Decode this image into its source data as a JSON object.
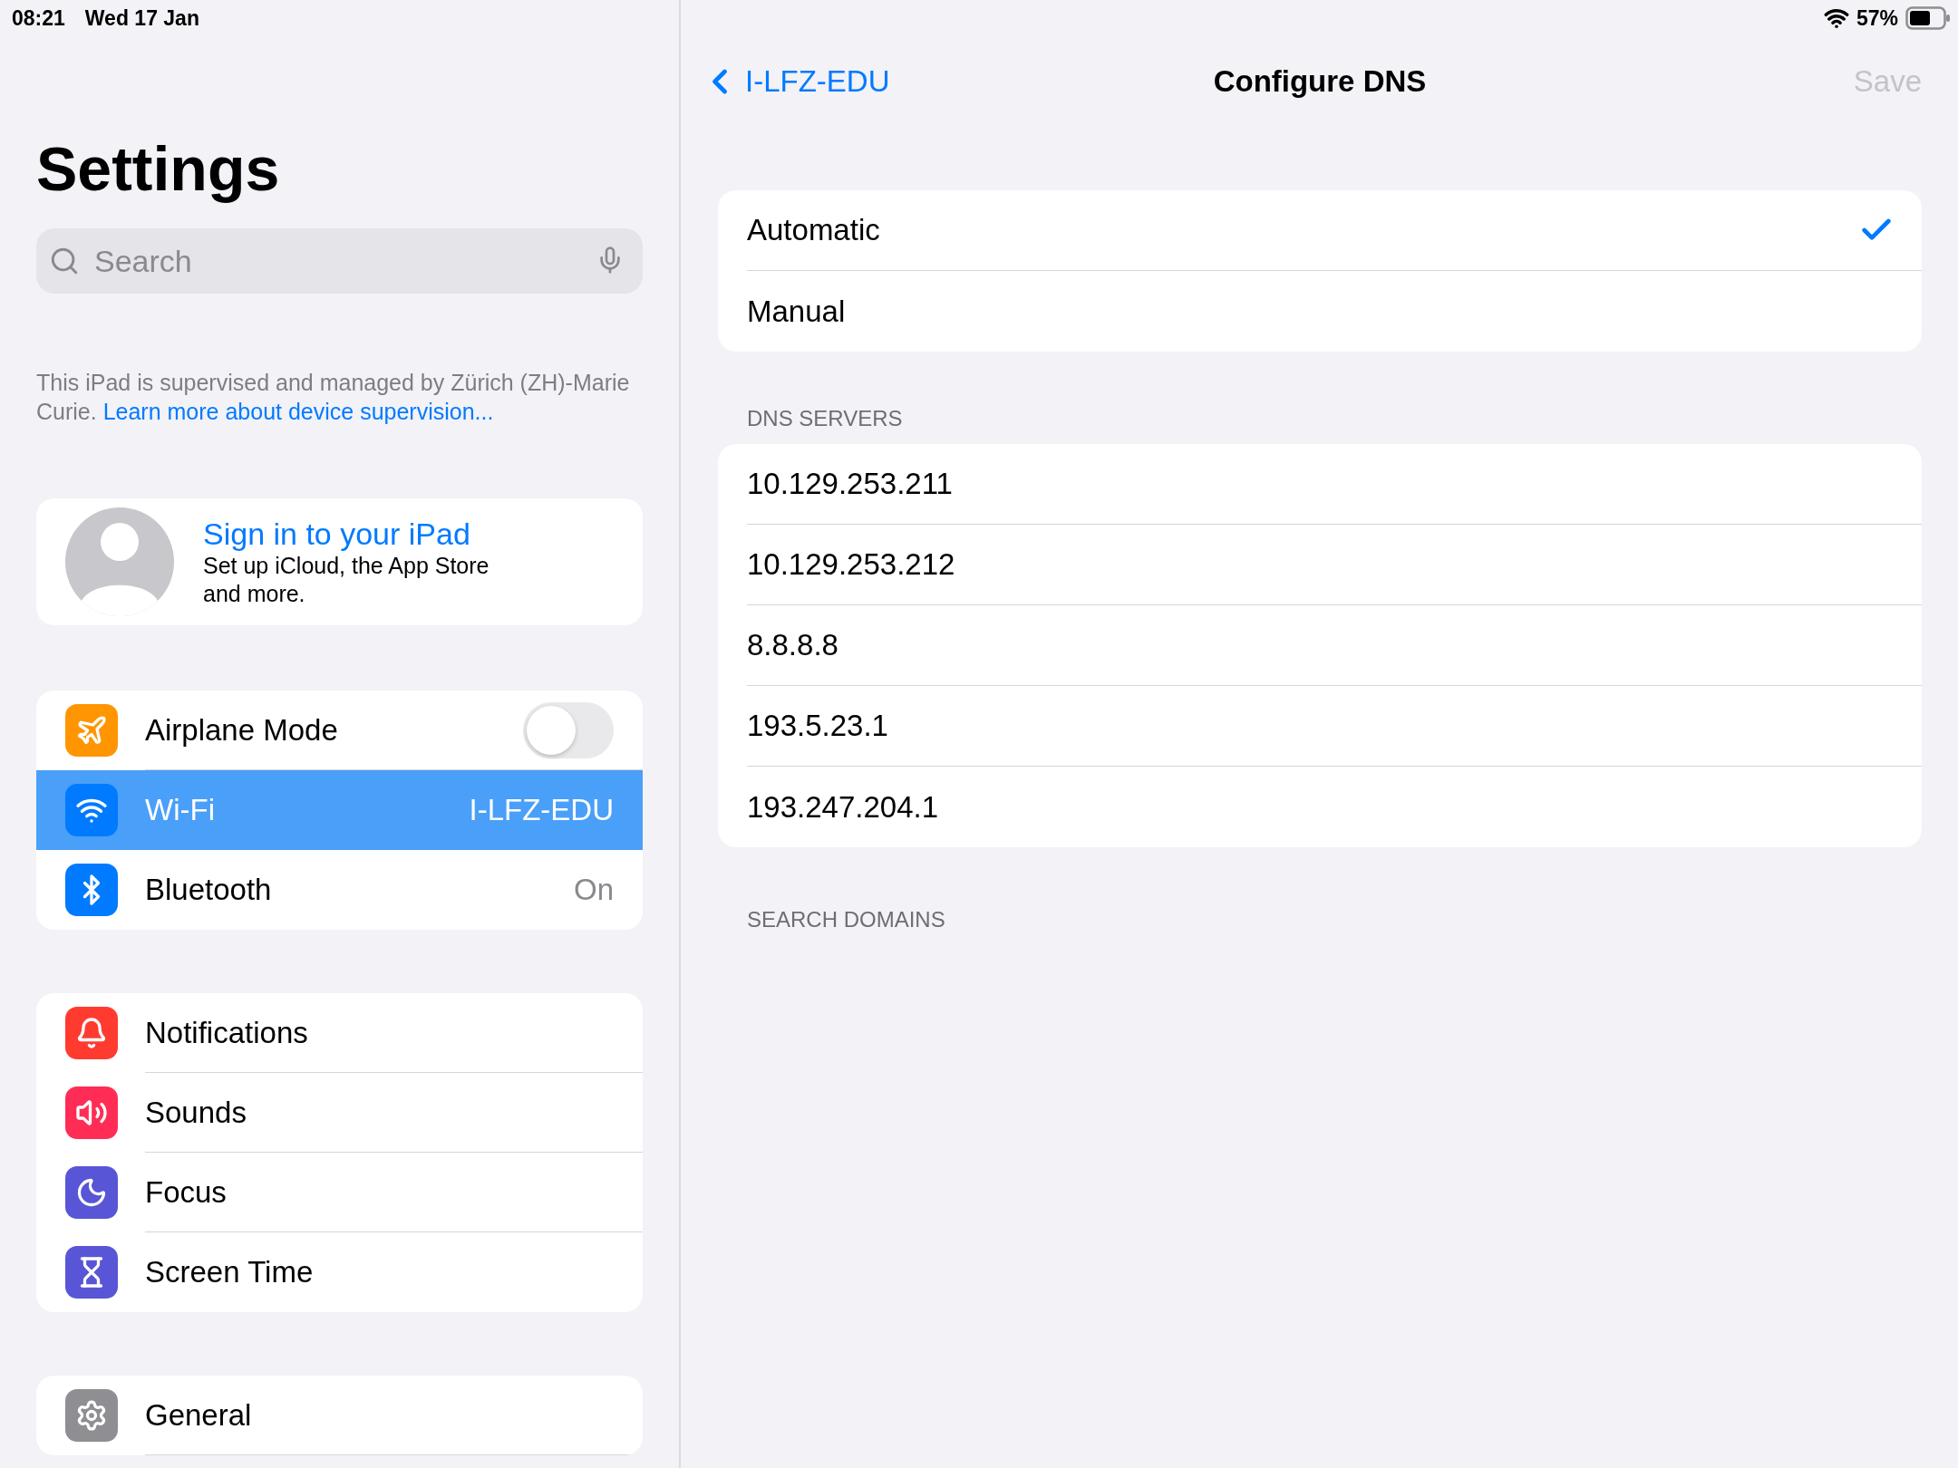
{
  "status_bar": {
    "time": "08:21",
    "date": "Wed 17 Jan",
    "battery_percent": "57%"
  },
  "sidebar": {
    "title": "Settings",
    "search": {
      "placeholder": "Search"
    },
    "supervision": {
      "text": "This iPad is supervised and managed by Zürich (ZH)-Marie Curie.",
      "link": "Learn more about device supervision..."
    },
    "sign_in": {
      "title": "Sign in to your iPad",
      "subtitle": "Set up iCloud, the App Store and more."
    },
    "groups": [
      [
        {
          "label": "Airplane Mode",
          "kind": "toggle",
          "on": false,
          "selected": false,
          "color": "#ff9500"
        },
        {
          "label": "Wi-Fi",
          "kind": "detail",
          "value": "I-LFZ-EDU",
          "selected": true,
          "color": "#007aff"
        },
        {
          "label": "Bluetooth",
          "kind": "detail",
          "value": "On",
          "selected": false,
          "color": "#007aff"
        }
      ],
      [
        {
          "label": "Notifications",
          "kind": "detail",
          "selected": false,
          "color": "#ff3b30"
        },
        {
          "label": "Sounds",
          "kind": "detail",
          "selected": false,
          "color": "#ff2d55"
        },
        {
          "label": "Focus",
          "kind": "detail",
          "selected": false,
          "color": "#5856d6"
        },
        {
          "label": "Screen Time",
          "kind": "detail",
          "selected": false,
          "color": "#5856d6"
        }
      ],
      [
        {
          "label": "General",
          "kind": "detail",
          "selected": false,
          "color": "#8e8e93"
        }
      ]
    ]
  },
  "detail": {
    "back": "I-LFZ-EDU",
    "title": "Configure DNS",
    "save": {
      "label": "Save",
      "disabled": true
    },
    "modes": [
      {
        "label": "Automatic",
        "selected": true
      },
      {
        "label": "Manual",
        "selected": false
      }
    ],
    "dns_servers": {
      "header": "DNS SERVERS",
      "servers": [
        "10.129.253.211",
        "10.129.253.212",
        "8.8.8.8",
        "193.5.23.1",
        "193.247.204.1"
      ]
    },
    "search_domains": {
      "header": "SEARCH DOMAINS"
    }
  }
}
